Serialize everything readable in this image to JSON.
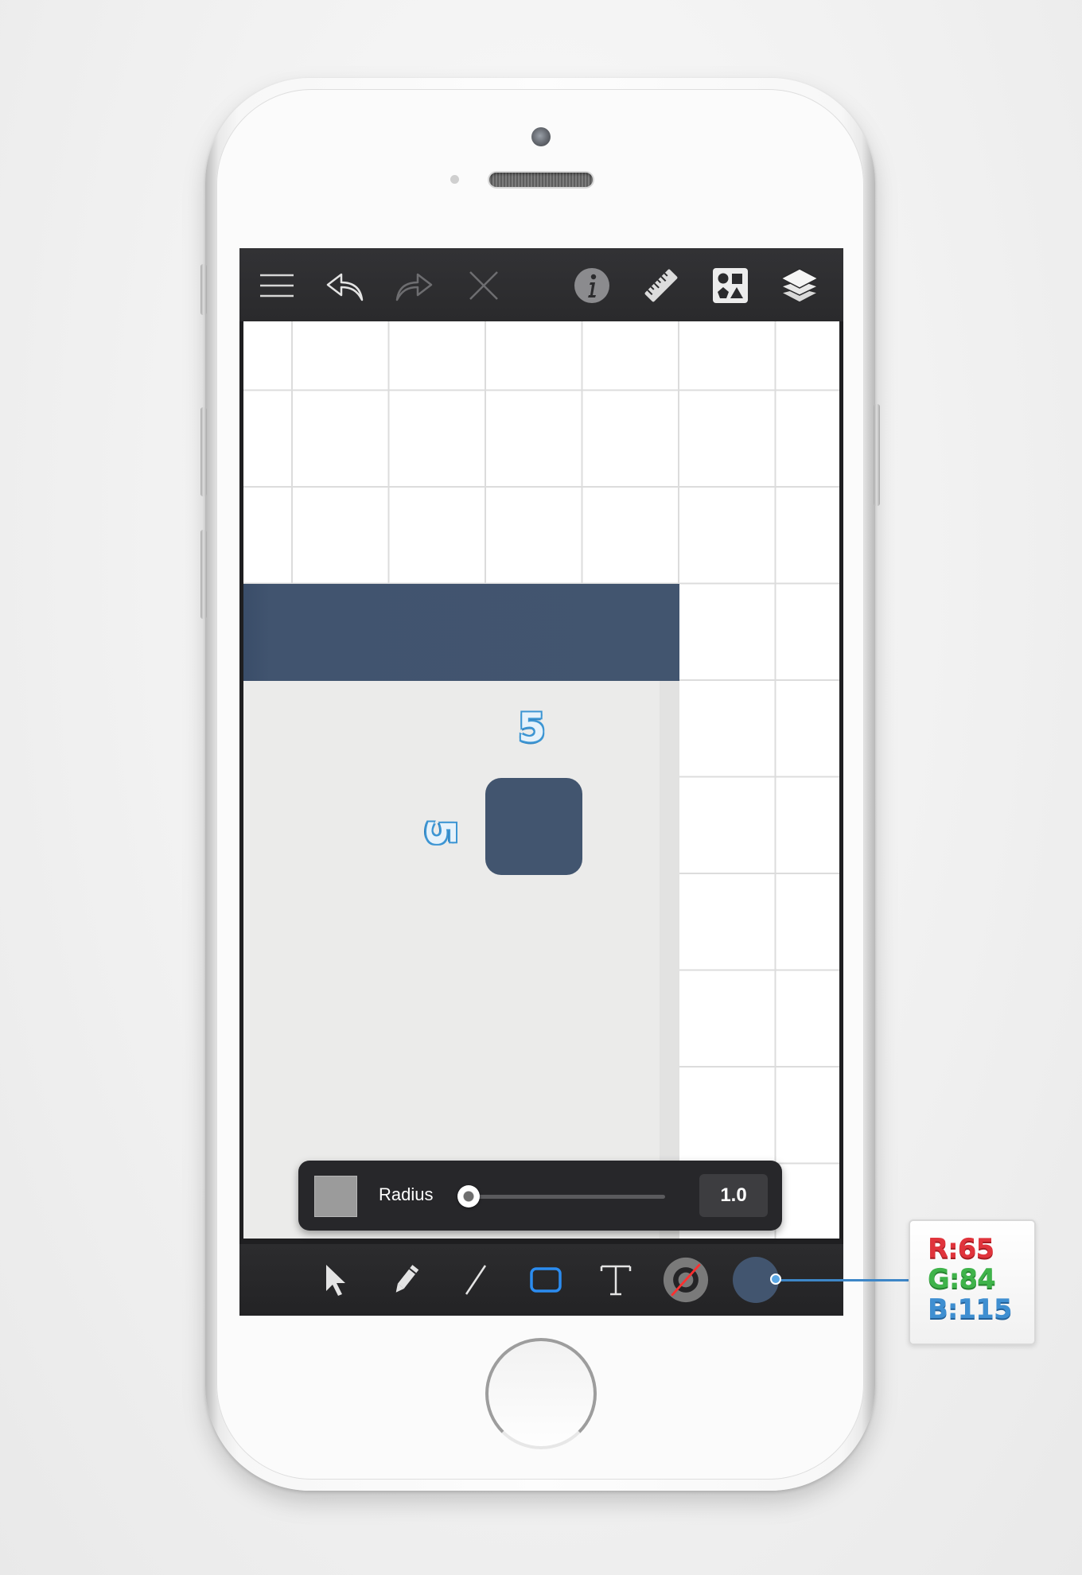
{
  "toolbar_top": {
    "items": [
      {
        "icon": "menu-icon"
      },
      {
        "icon": "undo-icon"
      },
      {
        "icon": "redo-icon"
      },
      {
        "icon": "close-icon"
      },
      {
        "icon": "info-icon"
      },
      {
        "icon": "ruler-icon"
      },
      {
        "icon": "shapes-library-icon"
      },
      {
        "icon": "layers-icon"
      }
    ]
  },
  "canvas": {
    "fill_color": "#42556F",
    "dimension_top": "5",
    "dimension_left": "5"
  },
  "radius_panel": {
    "label": "Radius",
    "value": "1.0",
    "slider_fraction": 0.0
  },
  "toolbar_bottom": {
    "tools": [
      {
        "icon": "select-arrow-icon"
      },
      {
        "icon": "pencil-icon"
      },
      {
        "icon": "line-icon"
      },
      {
        "icon": "rectangle-icon",
        "active": true
      },
      {
        "icon": "text-icon"
      },
      {
        "icon": "stroke-color-icon"
      },
      {
        "icon": "fill-color-icon"
      }
    ]
  },
  "color_callout": {
    "r_label": "R:",
    "r_value": "65",
    "g_label": "G:",
    "g_value": "84",
    "b_label": "B:",
    "b_value": "115"
  },
  "colors": {
    "accent": "#3C95D3",
    "fill": "#42556F",
    "toolbar": "#2A2A2C"
  }
}
